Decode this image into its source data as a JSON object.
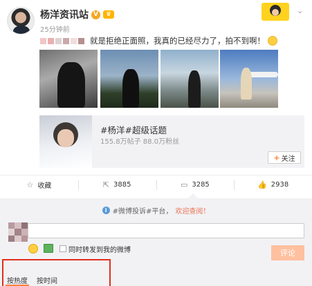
{
  "post": {
    "author": "杨洋资讯站",
    "verified_mark": "V",
    "vip_mark": "♛",
    "time": "25分钟前",
    "menu_arrow": "⌄",
    "text": "就是拒绝正面照，我真的已经尽力了，拍不到啊！",
    "mosaic_colors": [
      "#f3c6c6",
      "#e9b0b0",
      "#ddd2d2",
      "#c9a9a9",
      "#f0dede",
      "#b78f8f"
    ],
    "photos": [
      "photo-1",
      "photo-2",
      "photo-3",
      "photo-4"
    ]
  },
  "topic": {
    "title": "#杨洋#超级话题",
    "stats": "155.8万帖子 88.0万粉丝",
    "follow_plus": "+",
    "follow_label": "关注"
  },
  "actions": {
    "favorite": {
      "icon": "☆",
      "label": "收藏"
    },
    "repost": {
      "icon": "⇱",
      "label": "3885"
    },
    "comment": {
      "icon": "▭",
      "label": "3285"
    },
    "like": {
      "icon": "👍",
      "label": "2938"
    }
  },
  "comment_panel": {
    "notice_icon": "i",
    "notice_text": "#微博投诉#平台，",
    "notice_link": "欢迎查阅！",
    "input_value": "",
    "repost_label": "同时转发到我的微博",
    "submit_label": "评论"
  },
  "sort": {
    "hot": "按热度",
    "time": "按时间"
  },
  "colors": {
    "accent": "#ff8140",
    "highlight_box": "#e0301e",
    "panel_bg": "#f2f2f5"
  }
}
